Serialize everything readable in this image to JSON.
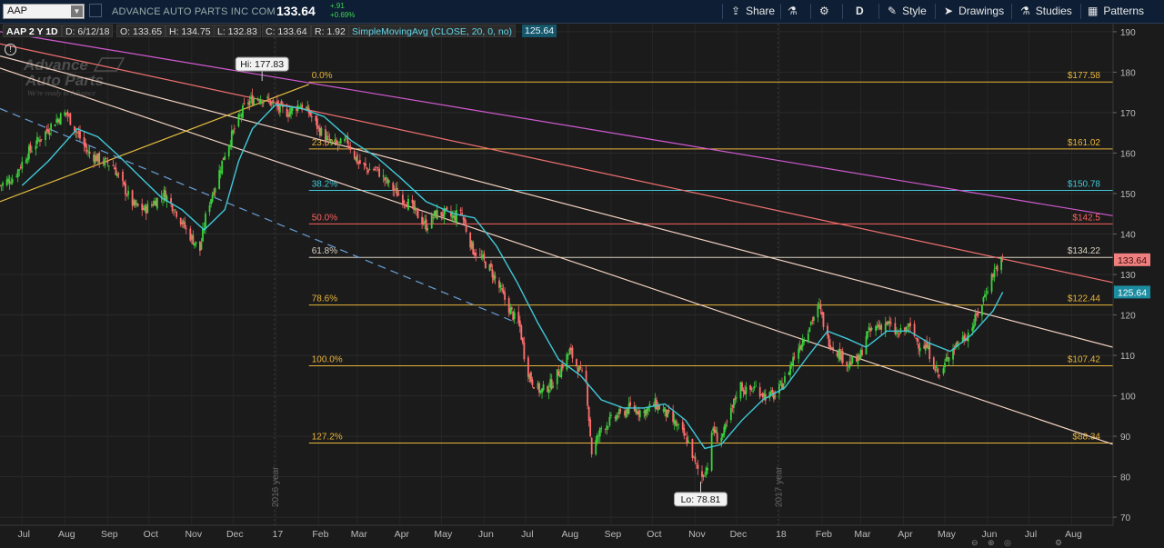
{
  "toolbar": {
    "symbol": "AAP",
    "company": "ADVANCE AUTO PARTS INC COM",
    "last_price": "133.64",
    "change_abs": "+.91",
    "change_pct": "+0.69%",
    "share_label": "Share",
    "timeframe_label": "D",
    "style_label": "Style",
    "drawings_label": "Drawings",
    "studies_label": "Studies",
    "patterns_label": "Patterns",
    "icons": [
      "share-icon",
      "flask-icon",
      "gear-icon",
      "paintbrush-icon",
      "cursor-icon",
      "studies-flask-icon",
      "patterns-icon"
    ]
  },
  "infobar": {
    "aggregation": "AAP 2 Y 1D",
    "date": "D: 6/12/18",
    "open": "O: 133.65",
    "high": "H: 134.75",
    "low": "L: 132.83",
    "close": "C: 133.64",
    "range": "R: 1.92",
    "sma_label": "SimpleMovingAvg (CLOSE, 20, 0, no)",
    "sma_value": "125.64"
  },
  "watermark": {
    "logo_line1": "Advance",
    "logo_line2": "Auto Parts",
    "tagline": "We're ready in Advance"
  },
  "colors": {
    "up": "#39d23c",
    "down": "#ff6e6e",
    "sma": "#3fc8d8",
    "fib": "#e8b53a",
    "fib_38": "#3fc8d8",
    "fib_50": "#ff6060",
    "fib_61": "#d8d0c0",
    "magenta": "#d25ad2",
    "salmon": "#f07070",
    "white_channel": "#f0d0c0",
    "trend_yellow": "#e8c040",
    "trend_blue": "#6aa0d8",
    "last_price_bg": "#f08080",
    "sma_bg": "#1c8ca0"
  },
  "chart_data": {
    "type": "candlestick",
    "title": "AAP 2 Y 1D",
    "ylim": [
      68,
      192
    ],
    "y_ticks": [
      70,
      80,
      90,
      100,
      110,
      120,
      130,
      140,
      150,
      160,
      170,
      180,
      190
    ],
    "x_range": [
      "2016-06-15",
      "2018-08-31"
    ],
    "x_ticks": [
      {
        "label": "Jul",
        "date": "2016-07-01"
      },
      {
        "label": "Aug",
        "date": "2016-08-01"
      },
      {
        "label": "Sep",
        "date": "2016-09-01"
      },
      {
        "label": "Oct",
        "date": "2016-10-01"
      },
      {
        "label": "Nov",
        "date": "2016-11-01"
      },
      {
        "label": "Dec",
        "date": "2016-12-01"
      },
      {
        "label": "17",
        "date": "2017-01-01"
      },
      {
        "label": "Feb",
        "date": "2017-02-01"
      },
      {
        "label": "Mar",
        "date": "2017-03-01"
      },
      {
        "label": "Apr",
        "date": "2017-04-01"
      },
      {
        "label": "May",
        "date": "2017-05-01"
      },
      {
        "label": "Jun",
        "date": "2017-06-01"
      },
      {
        "label": "Jul",
        "date": "2017-07-01"
      },
      {
        "label": "Aug",
        "date": "2017-08-01"
      },
      {
        "label": "Sep",
        "date": "2017-09-01"
      },
      {
        "label": "Oct",
        "date": "2017-10-01"
      },
      {
        "label": "Nov",
        "date": "2017-11-01"
      },
      {
        "label": "Dec",
        "date": "2017-12-01"
      },
      {
        "label": "18",
        "date": "2018-01-01"
      },
      {
        "label": "Feb",
        "date": "2018-02-01"
      },
      {
        "label": "Mar",
        "date": "2018-03-01"
      },
      {
        "label": "Apr",
        "date": "2018-04-01"
      },
      {
        "label": "May",
        "date": "2018-05-01"
      },
      {
        "label": "Jun",
        "date": "2018-06-01"
      },
      {
        "label": "Jul",
        "date": "2018-07-01"
      },
      {
        "label": "Aug",
        "date": "2018-08-01"
      }
    ],
    "year_markers": [
      {
        "label": "2016 year",
        "date": "2016-12-31"
      },
      {
        "label": "2017 year",
        "date": "2017-12-31"
      }
    ],
    "price_path": [
      [
        "2016-06-15",
        152
      ],
      [
        "2016-06-25",
        154
      ],
      [
        "2016-07-05",
        160
      ],
      [
        "2016-07-15",
        164
      ],
      [
        "2016-07-25",
        168
      ],
      [
        "2016-08-02",
        170
      ],
      [
        "2016-08-10",
        165
      ],
      [
        "2016-08-18",
        160
      ],
      [
        "2016-08-28",
        158
      ],
      [
        "2016-09-05",
        157
      ],
      [
        "2016-09-12",
        152
      ],
      [
        "2016-09-20",
        147
      ],
      [
        "2016-09-28",
        146
      ],
      [
        "2016-10-05",
        148
      ],
      [
        "2016-10-12",
        150
      ],
      [
        "2016-10-20",
        146
      ],
      [
        "2016-10-28",
        141
      ],
      [
        "2016-11-03",
        138
      ],
      [
        "2016-11-07",
        136
      ],
      [
        "2016-11-12",
        146
      ],
      [
        "2016-11-18",
        152
      ],
      [
        "2016-11-25",
        160
      ],
      [
        "2016-12-02",
        166
      ],
      [
        "2016-12-10",
        172
      ],
      [
        "2016-12-18",
        174
      ],
      [
        "2016-12-26",
        173
      ],
      [
        "2017-01-03",
        171
      ],
      [
        "2017-01-10",
        170
      ],
      [
        "2017-01-18",
        172
      ],
      [
        "2017-01-25",
        170
      ],
      [
        "2017-02-01",
        166
      ],
      [
        "2017-02-08",
        163
      ],
      [
        "2017-02-15",
        162
      ],
      [
        "2017-02-22",
        163
      ],
      [
        "2017-03-01",
        158
      ],
      [
        "2017-03-08",
        156
      ],
      [
        "2017-03-15",
        156
      ],
      [
        "2017-03-22",
        153
      ],
      [
        "2017-03-30",
        150
      ],
      [
        "2017-04-06",
        148
      ],
      [
        "2017-04-13",
        145
      ],
      [
        "2017-04-20",
        142
      ],
      [
        "2017-04-27",
        145
      ],
      [
        "2017-05-04",
        145
      ],
      [
        "2017-05-10",
        144
      ],
      [
        "2017-05-15",
        146
      ],
      [
        "2017-05-20",
        140
      ],
      [
        "2017-05-24",
        136
      ],
      [
        "2017-05-30",
        134
      ],
      [
        "2017-06-06",
        131
      ],
      [
        "2017-06-13",
        126
      ],
      [
        "2017-06-20",
        121
      ],
      [
        "2017-06-27",
        117
      ],
      [
        "2017-07-01",
        108
      ],
      [
        "2017-07-05",
        104
      ],
      [
        "2017-07-12",
        101
      ],
      [
        "2017-07-20",
        103
      ],
      [
        "2017-07-27",
        107
      ],
      [
        "2017-08-02",
        111
      ],
      [
        "2017-08-08",
        107
      ],
      [
        "2017-08-14",
        103
      ],
      [
        "2017-08-18",
        86
      ],
      [
        "2017-08-25",
        92
      ],
      [
        "2017-09-05",
        95
      ],
      [
        "2017-09-15",
        97
      ],
      [
        "2017-09-25",
        96
      ],
      [
        "2017-10-03",
        98
      ],
      [
        "2017-10-10",
        96
      ],
      [
        "2017-10-20",
        92
      ],
      [
        "2017-10-28",
        88
      ],
      [
        "2017-11-01",
        83
      ],
      [
        "2017-11-06",
        80
      ],
      [
        "2017-11-10",
        83
      ],
      [
        "2017-11-14",
        92
      ],
      [
        "2017-11-18",
        89
      ],
      [
        "2017-11-22",
        91
      ],
      [
        "2017-11-28",
        97
      ],
      [
        "2017-12-03",
        103
      ],
      [
        "2017-12-08",
        101
      ],
      [
        "2017-12-15",
        102
      ],
      [
        "2017-12-22",
        100
      ],
      [
        "2017-12-29",
        100
      ],
      [
        "2018-01-05",
        104
      ],
      [
        "2018-01-12",
        110
      ],
      [
        "2018-01-18",
        114
      ],
      [
        "2018-01-25",
        119
      ],
      [
        "2018-01-30",
        122
      ],
      [
        "2018-02-05",
        114
      ],
      [
        "2018-02-12",
        111
      ],
      [
        "2018-02-20",
        108
      ],
      [
        "2018-02-28",
        109
      ],
      [
        "2018-03-05",
        115
      ],
      [
        "2018-03-12",
        117
      ],
      [
        "2018-03-20",
        118
      ],
      [
        "2018-03-28",
        115
      ],
      [
        "2018-04-05",
        117
      ],
      [
        "2018-04-12",
        113
      ],
      [
        "2018-04-18",
        112
      ],
      [
        "2018-04-23",
        108
      ],
      [
        "2018-04-28",
        104
      ],
      [
        "2018-05-03",
        110
      ],
      [
        "2018-05-10",
        113
      ],
      [
        "2018-05-17",
        115
      ],
      [
        "2018-05-22",
        118
      ],
      [
        "2018-05-27",
        122
      ],
      [
        "2018-06-01",
        127
      ],
      [
        "2018-06-06",
        131
      ],
      [
        "2018-06-12",
        133.64
      ]
    ],
    "sma": [
      [
        "2016-07-01",
        152
      ],
      [
        "2016-07-20",
        158
      ],
      [
        "2016-08-10",
        166
      ],
      [
        "2016-08-25",
        164
      ],
      [
        "2016-09-10",
        159
      ],
      [
        "2016-09-25",
        154
      ],
      [
        "2016-10-10",
        149
      ],
      [
        "2016-10-25",
        146
      ],
      [
        "2016-11-10",
        141
      ],
      [
        "2016-11-25",
        146
      ],
      [
        "2016-12-05",
        158
      ],
      [
        "2016-12-15",
        166
      ],
      [
        "2017-01-01",
        172
      ],
      [
        "2017-01-20",
        171
      ],
      [
        "2017-02-05",
        169
      ],
      [
        "2017-02-25",
        163
      ],
      [
        "2017-03-15",
        159
      ],
      [
        "2017-04-01",
        154
      ],
      [
        "2017-04-20",
        148
      ],
      [
        "2017-05-10",
        145
      ],
      [
        "2017-05-25",
        144
      ],
      [
        "2017-06-10",
        137
      ],
      [
        "2017-06-25",
        128
      ],
      [
        "2017-07-10",
        118
      ],
      [
        "2017-07-25",
        109
      ],
      [
        "2017-08-10",
        105
      ],
      [
        "2017-08-25",
        99
      ],
      [
        "2017-09-10",
        97
      ],
      [
        "2017-09-25",
        97
      ],
      [
        "2017-10-10",
        98
      ],
      [
        "2017-10-25",
        94
      ],
      [
        "2017-11-08",
        87
      ],
      [
        "2017-11-20",
        88
      ],
      [
        "2017-12-05",
        94
      ],
      [
        "2017-12-20",
        99
      ],
      [
        "2018-01-05",
        102
      ],
      [
        "2018-01-20",
        109
      ],
      [
        "2018-02-05",
        116
      ],
      [
        "2018-02-20",
        114
      ],
      [
        "2018-03-05",
        112
      ],
      [
        "2018-03-20",
        116
      ],
      [
        "2018-04-05",
        116
      ],
      [
        "2018-04-20",
        113
      ],
      [
        "2018-05-05",
        111
      ],
      [
        "2018-05-20",
        115
      ],
      [
        "2018-06-05",
        121
      ],
      [
        "2018-06-12",
        125.64
      ]
    ],
    "fibonacci": {
      "start_date": "2017-01-25",
      "levels": [
        {
          "label": "0.0%",
          "price": 177.58,
          "price_label": "$177.58"
        },
        {
          "label": "23.6%",
          "price": 161.02,
          "price_label": "$161.02"
        },
        {
          "label": "38.2%",
          "price": 150.78,
          "price_label": "$150.78"
        },
        {
          "label": "50.0%",
          "price": 142.5,
          "price_label": "$142.5"
        },
        {
          "label": "61.8%",
          "price": 134.22,
          "price_label": "$134.22"
        },
        {
          "label": "78.6%",
          "price": 122.44,
          "price_label": "$122.44"
        },
        {
          "label": "100.0%",
          "price": 107.42,
          "price_label": "$107.42"
        },
        {
          "label": "127.2%",
          "price": 88.34,
          "price_label": "$88.34"
        }
      ]
    },
    "trendlines": [
      {
        "name": "magenta",
        "from": [
          "2016-06-15",
          190
        ],
        "to": [
          "2018-08-31",
          144.5
        ]
      },
      {
        "name": "salmon",
        "from": [
          "2016-06-15",
          187
        ],
        "to": [
          "2018-08-31",
          128
        ]
      },
      {
        "name": "white-upper",
        "from": [
          "2016-06-15",
          184
        ],
        "to": [
          "2018-08-31",
          112
        ]
      },
      {
        "name": "white-lower",
        "from": [
          "2016-06-15",
          181
        ],
        "to": [
          "2018-08-31",
          88
        ]
      },
      {
        "name": "yellow",
        "from": [
          "2016-06-15",
          148
        ],
        "to": [
          "2017-01-25",
          177
        ]
      },
      {
        "name": "blue-dashed",
        "from": [
          "2016-06-15",
          171
        ],
        "to": [
          "2017-06-25",
          118
        ]
      }
    ],
    "annotations": [
      {
        "label": "Hi: 177.83",
        "date": "2016-12-22",
        "price": 177.83
      },
      {
        "label": "Lo: 78.81",
        "date": "2017-11-05",
        "price": 78.81
      }
    ],
    "last_price_tag": {
      "label": "133.64",
      "value": 133.64
    },
    "sma_tag": {
      "label": "125.64",
      "value": 125.64
    }
  },
  "bottom_icons": [
    "zoom-out-icon",
    "zoom-in-icon",
    "fit-icon",
    "settings-icon"
  ]
}
